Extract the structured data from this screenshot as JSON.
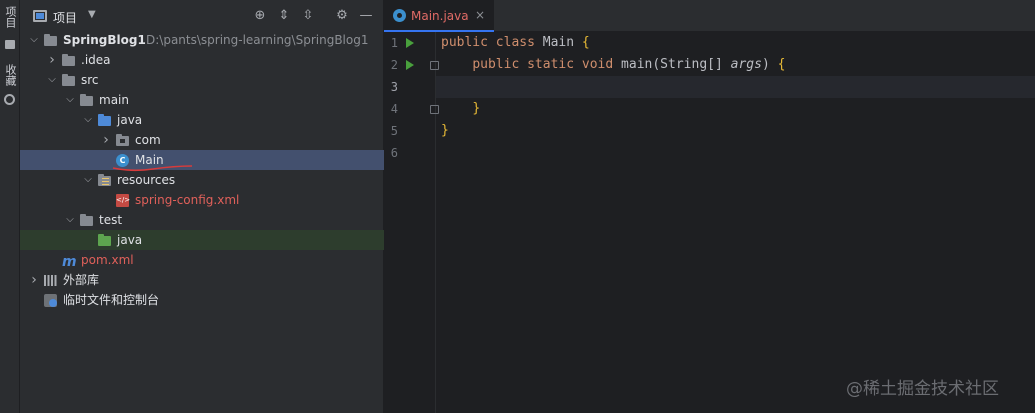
{
  "sidebar_strip": {
    "tabs": [
      "项目",
      "收藏"
    ]
  },
  "project_panel": {
    "title": "项目",
    "tree": [
      {
        "label": "SpringBlog1",
        "path": "D:\\pants\\spring-learning\\SpringBlog1",
        "depth": 0,
        "expanded": true,
        "icon": "module-folder-icon",
        "bold": true
      },
      {
        "label": ".idea",
        "depth": 1,
        "expanded": false,
        "icon": "folder-icon"
      },
      {
        "label": "src",
        "depth": 1,
        "expanded": true,
        "icon": "folder-icon"
      },
      {
        "label": "main",
        "depth": 2,
        "expanded": true,
        "icon": "folder-icon"
      },
      {
        "label": "java",
        "depth": 3,
        "expanded": true,
        "icon": "source-folder-icon"
      },
      {
        "label": "com",
        "depth": 4,
        "expanded": false,
        "icon": "package-icon"
      },
      {
        "label": "Main",
        "depth": 4,
        "icon": "java-class-icon",
        "selected": true
      },
      {
        "label": "resources",
        "depth": 3,
        "expanded": true,
        "icon": "resources-folder-icon"
      },
      {
        "label": "spring-config.xml",
        "depth": 4,
        "icon": "xml-file-icon",
        "red": true
      },
      {
        "label": "test",
        "depth": 2,
        "expanded": true,
        "icon": "folder-icon"
      },
      {
        "label": "java",
        "depth": 3,
        "icon": "test-source-folder-icon",
        "test": true
      },
      {
        "label": "pom.xml",
        "depth": 1,
        "icon": "maven-icon",
        "red": true
      },
      {
        "label": "外部库",
        "depth": 0,
        "expanded": false,
        "icon": "libraries-icon"
      },
      {
        "label": "临时文件和控制台",
        "depth": 0,
        "icon": "scratches-icon"
      }
    ]
  },
  "editor": {
    "tab": {
      "label": "Main.java",
      "close": "×"
    },
    "lines": [
      {
        "num": "1",
        "run": true,
        "tokens": [
          [
            "kw",
            "public "
          ],
          [
            "kw",
            "class "
          ],
          [
            "plain",
            "Main "
          ],
          [
            "brace",
            "{"
          ]
        ]
      },
      {
        "num": "2",
        "run": true,
        "fold": true,
        "tokens": [
          [
            "plain",
            "    "
          ],
          [
            "kw",
            "public "
          ],
          [
            "kw",
            "static "
          ],
          [
            "kw",
            "void "
          ],
          [
            "plain",
            "main(String[] "
          ],
          [
            "param",
            "args"
          ],
          [
            "plain",
            ") "
          ],
          [
            "brace",
            "{"
          ]
        ]
      },
      {
        "num": "3",
        "current": true,
        "tokens": []
      },
      {
        "num": "4",
        "fold": true,
        "tokens": [
          [
            "plain",
            "    "
          ],
          [
            "brace",
            "}"
          ]
        ]
      },
      {
        "num": "5",
        "tokens": [
          [
            "brace",
            "}"
          ]
        ]
      },
      {
        "num": "6",
        "tokens": []
      }
    ]
  },
  "watermark": "@稀土掘金技术社区",
  "colors": {
    "accent": "#3574f0",
    "selection": "#43506e",
    "keyword": "#cf8e6d",
    "error_red": "#e0605a",
    "run_green": "#49a03d"
  }
}
